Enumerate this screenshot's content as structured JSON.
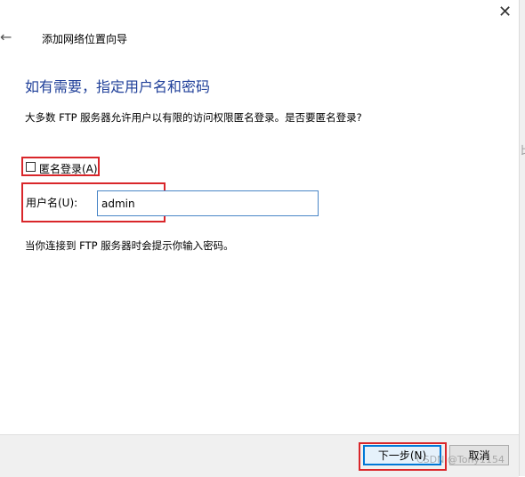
{
  "window": {
    "title": "添加网络位置向导",
    "close_glyph": "✕",
    "back_glyph": "←"
  },
  "heading": "如有需要，指定用户名和密码",
  "description": "大多数 FTP 服务器允许用户以有限的访问权限匿名登录。是否要匿名登录?",
  "anonymous_login": {
    "label": "匿名登录(A)",
    "checked": false
  },
  "username": {
    "label": "用户名(U):",
    "value": "admin"
  },
  "hint": "当你连接到 FTP 服务器时会提示你输入密码。",
  "buttons": {
    "next": "下一步(N)",
    "cancel": "取消"
  },
  "watermark": "CSDN @Tony1154",
  "side_glyph": "比",
  "colors": {
    "heading": "#1f3f99",
    "highlight": "#d9262a",
    "focus": "#0078d7"
  },
  "icons": {
    "close": "close-icon",
    "back": "back-arrow-icon"
  }
}
